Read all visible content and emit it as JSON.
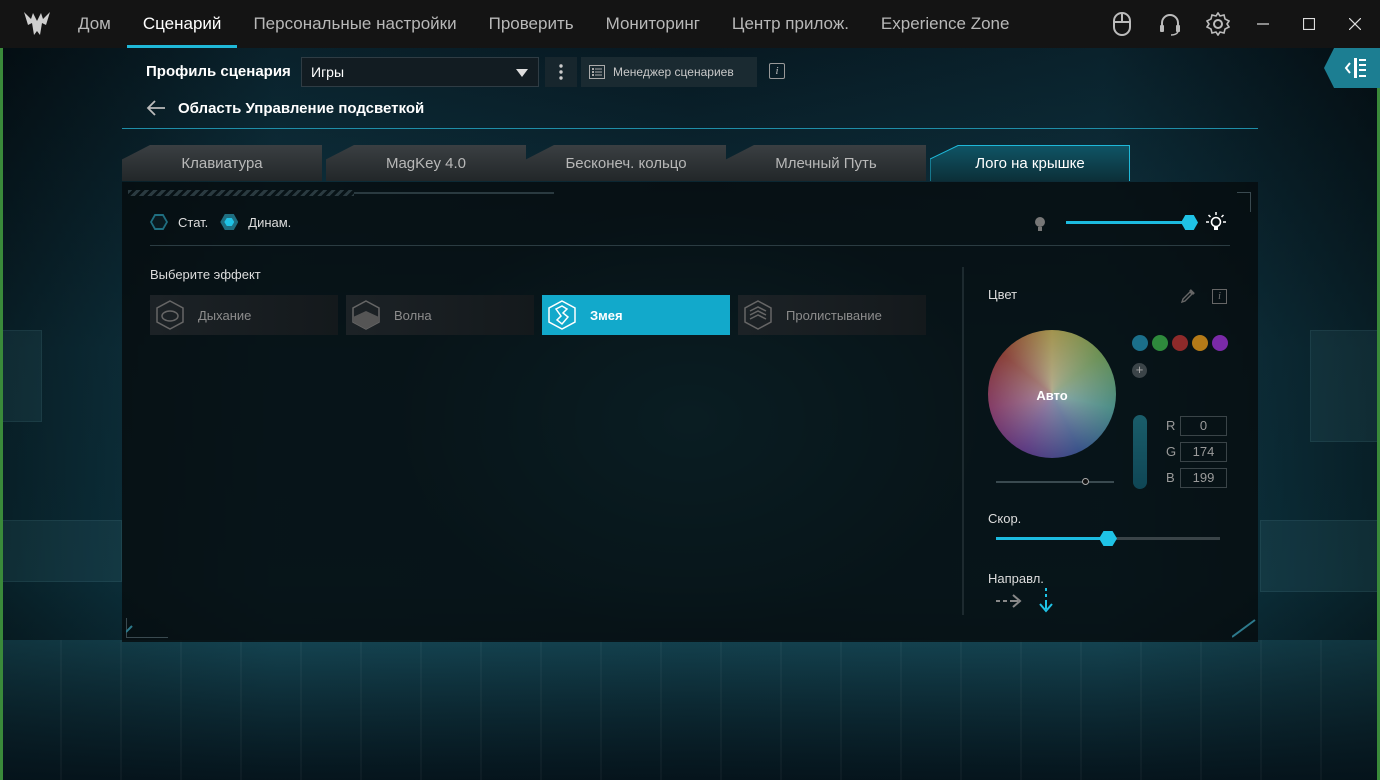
{
  "nav": {
    "items": [
      {
        "label": "Дом",
        "active": false
      },
      {
        "label": "Сценарий",
        "active": true
      },
      {
        "label": "Персональные настройки",
        "active": false
      },
      {
        "label": "Проверить",
        "active": false
      },
      {
        "label": "Мониторинг",
        "active": false
      },
      {
        "label": "Центр прилож.",
        "active": false
      },
      {
        "label": "Experience Zone",
        "active": false
      }
    ],
    "icons": [
      "mouse-icon",
      "headset-icon",
      "gear-icon"
    ],
    "window_controls": [
      "minimize-icon",
      "maximize-icon",
      "close-icon"
    ]
  },
  "profile": {
    "label": "Профиль сценария",
    "selected": "Игры",
    "manager_button": "Менеджер сценариев",
    "info_glyph": "i"
  },
  "breadcrumb": {
    "title": "Область Управление подсветкой"
  },
  "tabs": [
    {
      "label": "Клавиатура",
      "active": false
    },
    {
      "label": "MagKey 4.0",
      "active": false
    },
    {
      "label": "Бесконеч. кольцо",
      "active": false
    },
    {
      "label": "Млечный Путь",
      "active": false
    },
    {
      "label": "Лого на крышке",
      "active": true
    }
  ],
  "mode": {
    "static_label": "Стат.",
    "dynamic_label": "Динам.",
    "selected": "dynamic",
    "brightness_fraction": 1.0
  },
  "effects": {
    "label": "Выберите эффект",
    "items": [
      {
        "label": "Дыхание",
        "active": false
      },
      {
        "label": "Волна",
        "active": false
      },
      {
        "label": "Змея",
        "active": true
      },
      {
        "label": "Пролистывание",
        "active": false
      }
    ]
  },
  "color": {
    "label": "Цвет",
    "wheel_label": "Авто",
    "swatches": [
      "#1b6f8a",
      "#2e8a3c",
      "#8e2a2a",
      "#b47a18",
      "#7a2aa8"
    ],
    "add_glyph": "+",
    "r_label": "R",
    "r": "0",
    "g_label": "G",
    "g": "174",
    "b_label": "B",
    "b": "199",
    "info_glyph": "i"
  },
  "speed": {
    "label": "Скор.",
    "fraction": 0.5
  },
  "direction": {
    "label": "Направл.",
    "selected": "down"
  },
  "accent": "#1fb8d8"
}
